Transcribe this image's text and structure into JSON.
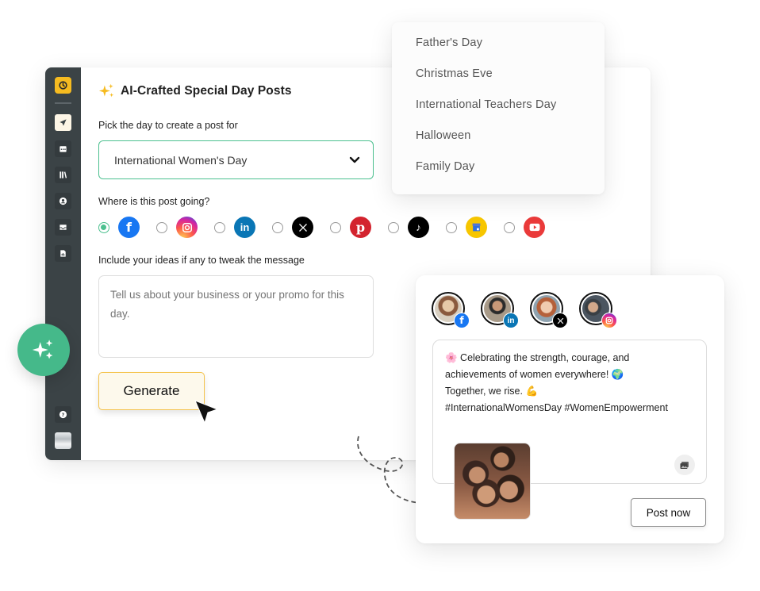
{
  "app": {
    "title": "AI-Crafted Special Day Posts",
    "accent_color": "#4cc08f",
    "brand_color": "#f6bb20"
  },
  "sidebar": {
    "logo_icon": "history-clock-icon",
    "items": [
      {
        "icon": "send-icon",
        "active": true
      },
      {
        "icon": "calendar-icon",
        "active": false
      },
      {
        "icon": "library-icon",
        "active": false
      },
      {
        "icon": "user-circle-icon",
        "active": false
      },
      {
        "icon": "inbox-icon",
        "active": false
      },
      {
        "icon": "report-icon",
        "active": false
      }
    ],
    "help_icon": "help-icon",
    "avatar": "user-avatar"
  },
  "form": {
    "day_label": "Pick the day to create a post for",
    "selected_day": "International Women's Day",
    "platform_label": "Where is this post going?",
    "platforms": [
      {
        "name": "Facebook",
        "icon": "facebook-icon",
        "selected": true,
        "color": "#1877f2",
        "glyph": "f"
      },
      {
        "name": "Instagram",
        "icon": "instagram-icon",
        "selected": false,
        "color": "#e1306c",
        "glyph": "◎"
      },
      {
        "name": "LinkedIn",
        "icon": "linkedin-icon",
        "selected": false,
        "color": "#0a66c2",
        "glyph": "in"
      },
      {
        "name": "X",
        "icon": "x-icon",
        "selected": false,
        "color": "#000000",
        "glyph": "𝕏"
      },
      {
        "name": "Pinterest",
        "icon": "pinterest-icon",
        "selected": false,
        "color": "#e60023",
        "glyph": "P"
      },
      {
        "name": "TikTok",
        "icon": "tiktok-icon",
        "selected": false,
        "color": "#000000",
        "glyph": "♪"
      },
      {
        "name": "Google Business Profile",
        "icon": "google-business-icon",
        "selected": false,
        "color": "#fbc02d",
        "glyph": "▦"
      },
      {
        "name": "YouTube",
        "icon": "youtube-icon",
        "selected": false,
        "color": "#ff0000",
        "glyph": "▶"
      }
    ],
    "ideas_label": "Include your ideas if any to tweak the message",
    "ideas_placeholder": "Tell us about your business or your promo for this day.",
    "ideas_value": "",
    "generate_label": "Generate"
  },
  "dropdown": {
    "options": [
      "Father's Day",
      "Christmas Eve",
      "International Teachers Day",
      "Halloween",
      "Family Day"
    ]
  },
  "preview": {
    "accounts": [
      {
        "network": "facebook",
        "badge_color": "#1877f2",
        "glyph": "f"
      },
      {
        "network": "linkedin",
        "badge_color": "#0a66c2",
        "glyph": "in"
      },
      {
        "network": "x",
        "badge_color": "#000000",
        "glyph": "𝕏"
      },
      {
        "network": "instagram",
        "badge_color": "#d62976",
        "glyph": "◎"
      }
    ],
    "post_lines": [
      "🌸 Celebrating the strength, courage, and",
      "achievements of women everywhere! 🌍",
      "Together, we rise. 💪",
      "#InternationalWomensDay #WomenEmpowerment"
    ],
    "post_now_label": "Post now"
  }
}
